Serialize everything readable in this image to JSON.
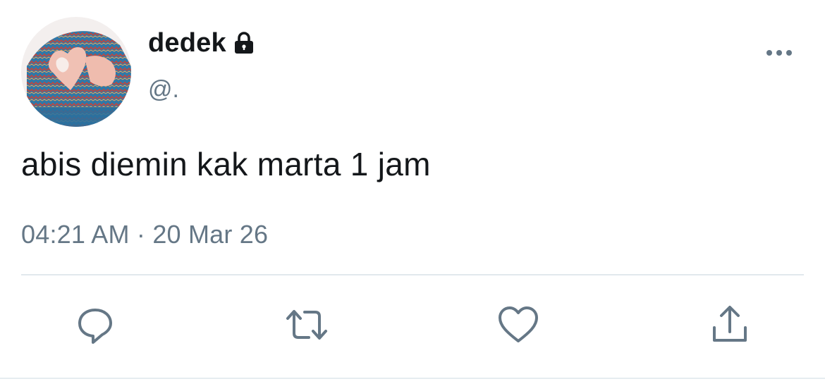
{
  "tweet": {
    "display_name": "dedek",
    "handle": "@.",
    "text": "abis diemin kak marta 1 jam",
    "time": "04:21 AM",
    "separator": "·",
    "date": "20 Mar 26",
    "protected": true
  },
  "icons": {
    "lock": "lock-icon",
    "more": "more-horizontal-icon",
    "reply": "reply-icon",
    "retweet": "retweet-icon",
    "like": "heart-icon",
    "share": "share-icon"
  },
  "colors": {
    "primary_text": "#14171a",
    "secondary_text": "#657786",
    "icon": "#657786",
    "divider": "#e1e8ed"
  }
}
